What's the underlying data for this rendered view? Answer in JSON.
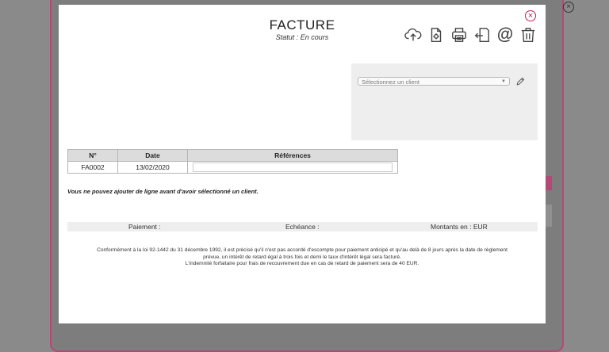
{
  "invoice": {
    "title": "FACTURE",
    "status": "Statut : En cours"
  },
  "toolbar": {
    "icons": [
      "cloud-upload-icon",
      "document-settings-icon",
      "print-icon",
      "export-icon",
      "email-icon",
      "trash-icon"
    ],
    "at_symbol": "@"
  },
  "client": {
    "placeholder": "Sélectionnez un client"
  },
  "table": {
    "headers": [
      "N°",
      "Date",
      "Références"
    ],
    "row": {
      "number": "FA0002",
      "date": "13/02/2020",
      "reference": ""
    }
  },
  "warning": "Vous ne pouvez ajouter de ligne avant d'avoir sélectionné un client.",
  "footer_bar": {
    "payment": "Paiement :",
    "due": "Echéance :",
    "currency": "Montants en : EUR"
  },
  "legal": {
    "line1": "Conformément à la loi 92-1442 du 31 décembre 1992, il est précisé qu'il n'est pas accordé d'escompte pour paiement anticipé et qu'au delà de 8 jours après la date de règlement",
    "line2": "prévue, un intérêt de retard égal à trois fois et demi le taux d'intérêt légal sera facturé.",
    "line3": "L'indemnité forfaitaire pour frais de recouvrement due en cas de retard de paiement sera de 40 EUR."
  },
  "colors": {
    "accent": "#c2185b",
    "overlay": "#8a8a8a",
    "panel": "#eeeeee"
  }
}
